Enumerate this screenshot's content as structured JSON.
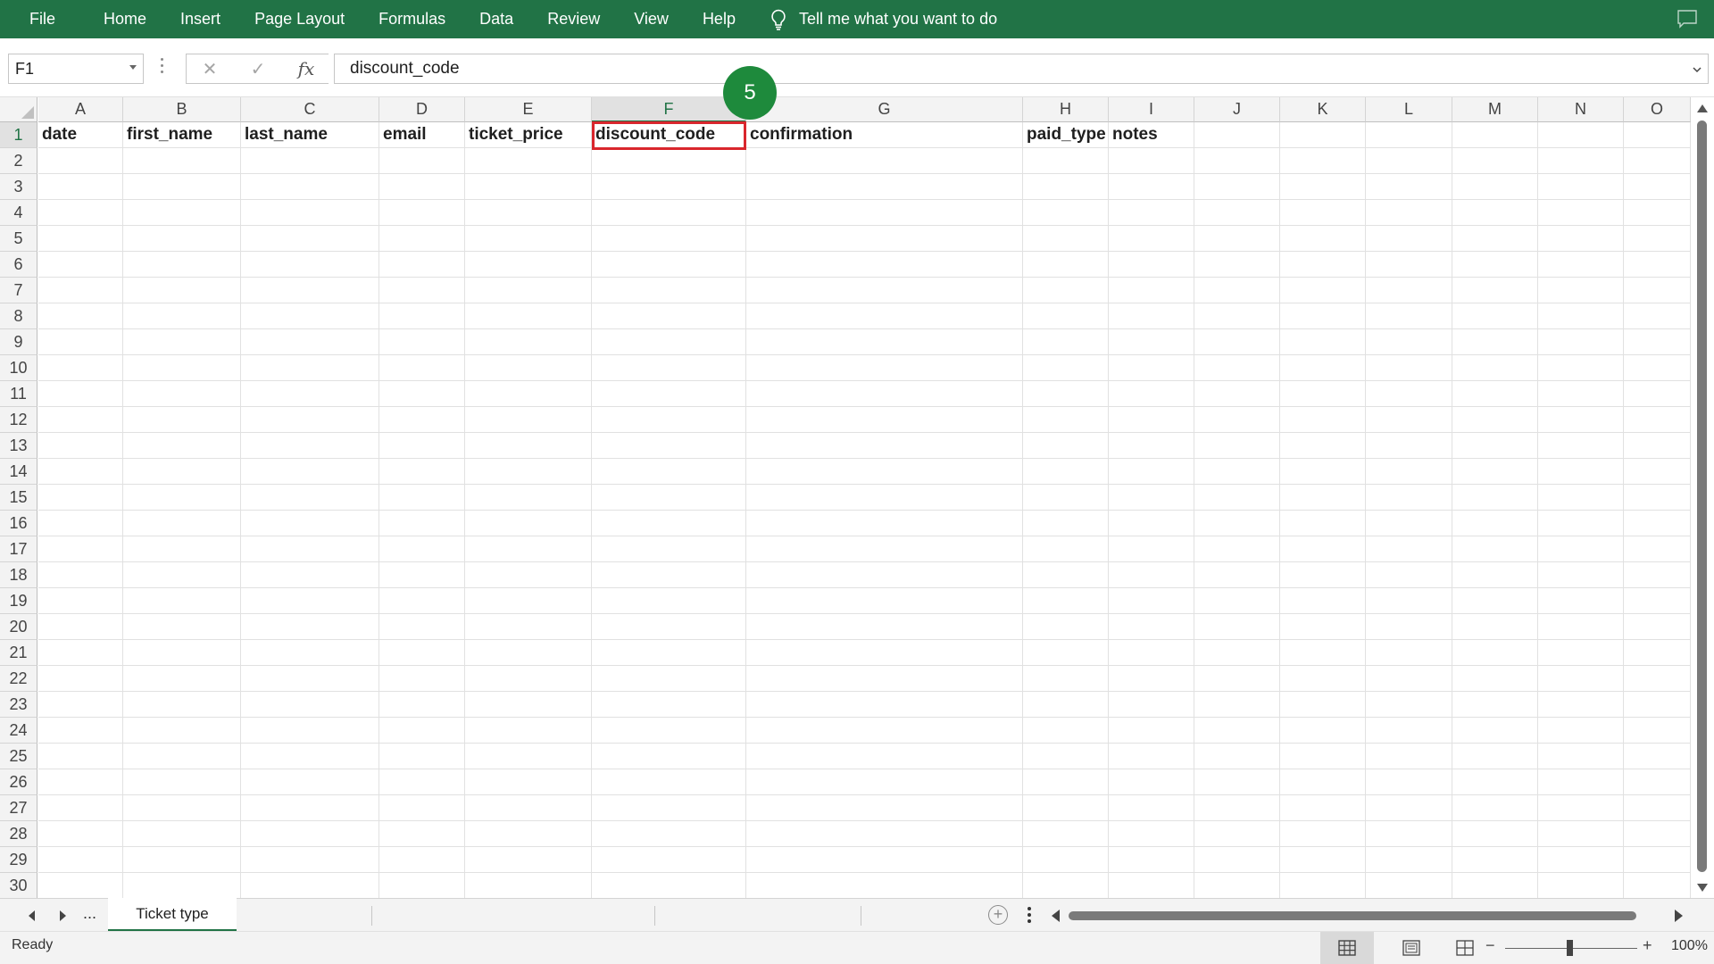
{
  "menu": {
    "items": [
      "File",
      "Home",
      "Insert",
      "Page Layout",
      "Formulas",
      "Data",
      "Review",
      "View",
      "Help"
    ],
    "tell_me": "Tell me what you want to do"
  },
  "formula_bar": {
    "name_box": "F1",
    "fx_symbol": "fx",
    "value": "discount_code"
  },
  "grid": {
    "columns": [
      "A",
      "B",
      "C",
      "D",
      "E",
      "F",
      "G",
      "H",
      "I",
      "J",
      "K",
      "L",
      "M",
      "N",
      "O"
    ],
    "rows": [
      "1",
      "2",
      "3",
      "4",
      "5",
      "6",
      "7",
      "8",
      "9",
      "10",
      "11",
      "12",
      "13",
      "14",
      "15",
      "16",
      "17",
      "18",
      "19",
      "20",
      "21",
      "22",
      "23",
      "24",
      "25",
      "26",
      "27",
      "28",
      "29",
      "30"
    ],
    "selected_column": "F",
    "selected_row": "1",
    "header_row": [
      "date",
      "first_name",
      "last_name",
      "email",
      "ticket_price",
      "discount_code",
      "confirmation",
      "paid_type",
      "notes"
    ]
  },
  "step_badge": "5",
  "sheets": {
    "active_tab": "Ticket type",
    "more": "..."
  },
  "status": {
    "text": "Ready",
    "zoom": "100%"
  },
  "colors": {
    "ribbon": "#217346",
    "selection_highlight": "#d9262d",
    "badge": "#1e8a3c"
  }
}
